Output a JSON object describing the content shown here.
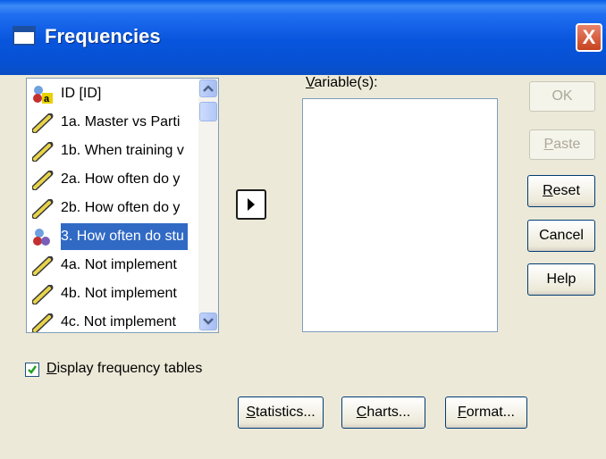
{
  "window": {
    "title": "Frequencies",
    "close_label": "X"
  },
  "source_list": {
    "items": [
      {
        "label": "ID [ID]",
        "icon": "nominal-variable-icon",
        "selected": false
      },
      {
        "label": "1a. Master vs Parti",
        "icon": "scale-variable-icon",
        "selected": false
      },
      {
        "label": "1b. When training v",
        "icon": "scale-variable-icon",
        "selected": false
      },
      {
        "label": "2a. How often do y",
        "icon": "scale-variable-icon",
        "selected": false
      },
      {
        "label": "2b. How often do y",
        "icon": "scale-variable-icon",
        "selected": false
      },
      {
        "label": "3. How often do stu",
        "icon": "ordinal-variable-icon",
        "selected": true
      },
      {
        "label": "4a. Not implement",
        "icon": "scale-variable-icon",
        "selected": false
      },
      {
        "label": "4b. Not implement",
        "icon": "scale-variable-icon",
        "selected": false
      },
      {
        "label": "4c. Not implement",
        "icon": "scale-variable-icon",
        "selected": false
      }
    ]
  },
  "move_button_icon": "right-arrow-icon",
  "variables": {
    "label_prefix": "",
    "label_mnemonic": "V",
    "label_rest": "ariable(s):"
  },
  "buttons": {
    "ok": "OK",
    "paste_m": "P",
    "paste_rest": "aste",
    "reset_m": "R",
    "reset_rest": "eset",
    "cancel": "Cancel",
    "help": "Help",
    "statistics_m": "S",
    "statistics_rest": "tatistics...",
    "charts_m": "C",
    "charts_rest": "harts...",
    "format_m": "F",
    "format_rest": "ormat..."
  },
  "display_tables": {
    "checked": true,
    "label_m": "D",
    "label_rest": "isplay frequency tables"
  }
}
